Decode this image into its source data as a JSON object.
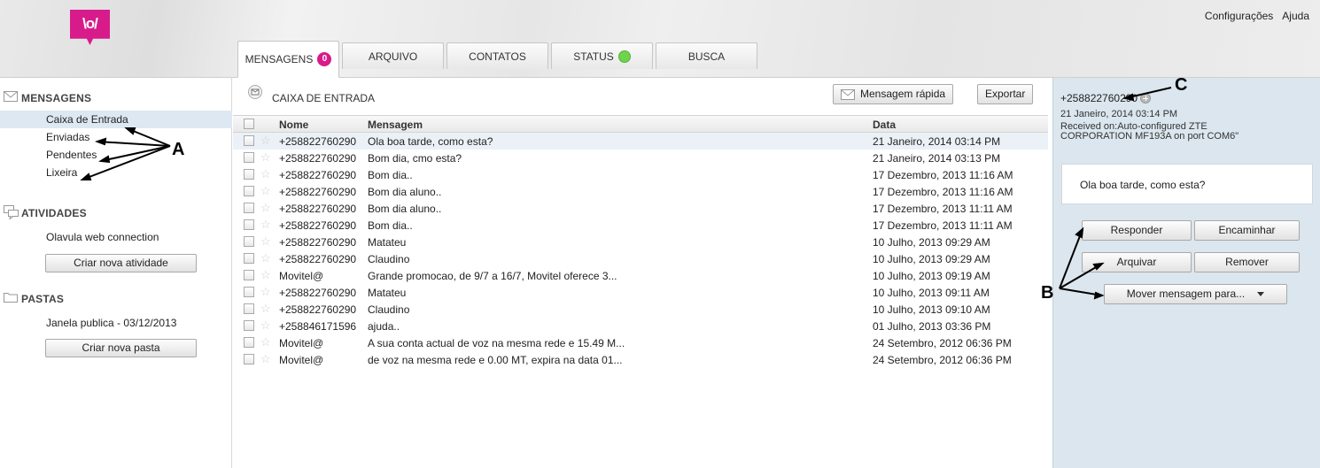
{
  "header": {
    "logo_text": "\\o/",
    "links": [
      "Configurações",
      "Ajuda"
    ],
    "tabs": [
      {
        "label": "MENSAGENS",
        "badge": "0"
      },
      {
        "label": "ARQUIVO"
      },
      {
        "label": "CONTATOS"
      },
      {
        "label": "STATUS"
      },
      {
        "label": "BUSCA"
      }
    ]
  },
  "sidebar": {
    "messages_title": "MENSAGENS",
    "folders": [
      "Caixa de Entrada",
      "Enviadas",
      "Pendentes",
      "Lixeira"
    ],
    "activities_title": "ATIVIDADES",
    "activity_item": "Olavula web connection",
    "new_activity_button": "Criar nova atividade",
    "folders_title": "PASTAS",
    "folder_item": "Janela publica - 03/12/2013",
    "new_folder_button": "Criar nova pasta"
  },
  "main": {
    "title": "CAIXA DE ENTRADA",
    "quick_message_button": "Mensagem rápida",
    "export_button": "Exportar",
    "columns": {
      "name": "Nome",
      "message": "Mensagem",
      "date": "Data"
    },
    "rows": [
      {
        "name": "+258822760290",
        "message": "Ola boa tarde, como esta?",
        "date": "21 Janeiro, 2014 03:14 PM"
      },
      {
        "name": "+258822760290",
        "message": "Bom dia, cmo esta?",
        "date": "21 Janeiro, 2014 03:13 PM"
      },
      {
        "name": "+258822760290",
        "message": "Bom dia..",
        "date": "17 Dezembro, 2013 11:16 AM"
      },
      {
        "name": "+258822760290",
        "message": "Bom dia aluno..",
        "date": "17 Dezembro, 2013 11:16 AM"
      },
      {
        "name": "+258822760290",
        "message": "Bom dia aluno..",
        "date": "17 Dezembro, 2013 11:11 AM"
      },
      {
        "name": "+258822760290",
        "message": "Bom dia..",
        "date": "17 Dezembro, 2013 11:11 AM"
      },
      {
        "name": "+258822760290",
        "message": "Matateu",
        "date": "10 Julho, 2013 09:29 AM"
      },
      {
        "name": "+258822760290",
        "message": "Claudino",
        "date": "10 Julho, 2013 09:29 AM"
      },
      {
        "name": "Movitel@",
        "message": "Grande promocao, de 9/7 a 16/7, Movitel oferece 3...",
        "date": "10 Julho, 2013 09:19 AM"
      },
      {
        "name": "+258822760290",
        "message": "Matateu",
        "date": "10 Julho, 2013 09:11 AM"
      },
      {
        "name": "+258822760290",
        "message": "Claudino",
        "date": "10 Julho, 2013 09:10 AM"
      },
      {
        "name": "+258846171596",
        "message": "ajuda..",
        "date": "01 Julho, 2013 03:36 PM"
      },
      {
        "name": "Movitel@",
        "message": "A sua conta actual de voz na mesma rede e 15.49 M...",
        "date": "24 Setembro, 2012 06:36 PM"
      },
      {
        "name": "Movitel@",
        "message": "de voz na mesma rede e 0.00 MT, expira na data 01...",
        "date": "24 Setembro, 2012 06:36 PM"
      }
    ]
  },
  "detail": {
    "from": "+258822760290",
    "date": "21 Janeiro, 2014 03:14 PM",
    "received": "Received on:Auto-configured ZTE CORPORATION MF193A on port COM6\"",
    "body": "Ola boa tarde, como esta?",
    "reply_button": "Responder",
    "forward_button": "Encaminhar",
    "archive_button": "Arquivar",
    "remove_button": "Remover",
    "move_button": "Mover mensagem para..."
  },
  "annotations": {
    "a": "A",
    "b": "B",
    "c": "C"
  },
  "colors": {
    "brand": "#d81b8a",
    "status_online": "#6fd44b",
    "panel_bg": "#dbe6ee",
    "selected_row": "#dde8f2"
  }
}
